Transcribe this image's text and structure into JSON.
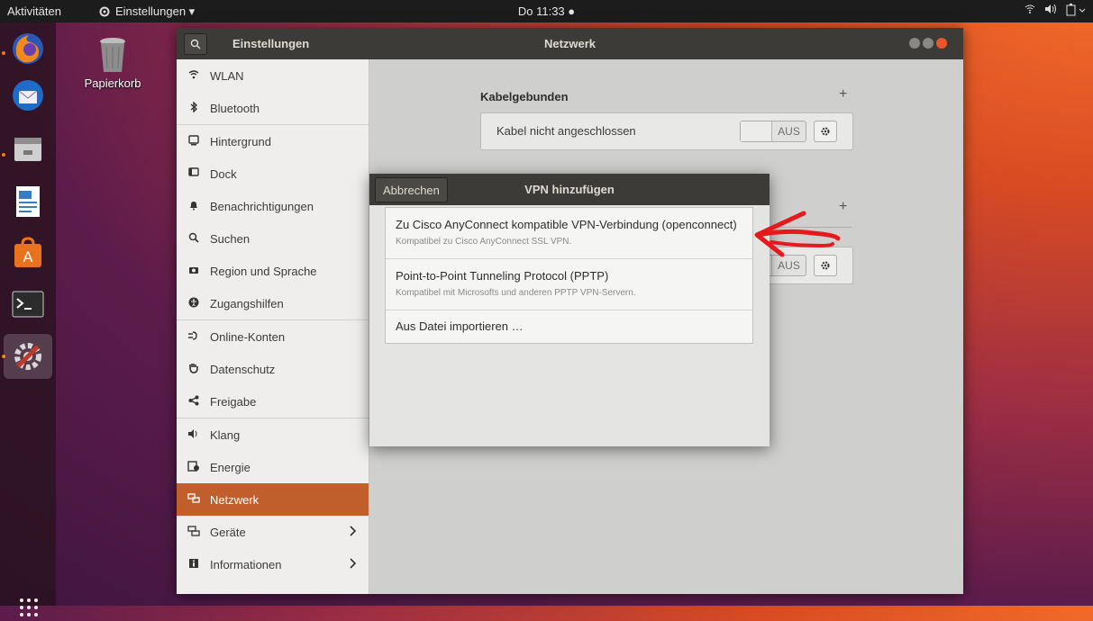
{
  "topbar": {
    "activities": "Aktivitäten",
    "app_menu": "Einstellungen ▾",
    "clock": "Do 11:33 ●"
  },
  "desktop": {
    "trash_label": "Papierkorb"
  },
  "window": {
    "sidebar_title": "Einstellungen",
    "title": "Netzwerk"
  },
  "sidebar": {
    "items": [
      {
        "label": "WLAN",
        "icon": "wifi-icon"
      },
      {
        "label": "Bluetooth",
        "icon": "bluetooth-icon"
      },
      {
        "label": "Hintergrund",
        "icon": "background-icon"
      },
      {
        "label": "Dock",
        "icon": "dock-icon"
      },
      {
        "label": "Benachrichtigungen",
        "icon": "bell-icon"
      },
      {
        "label": "Suchen",
        "icon": "search-icon"
      },
      {
        "label": "Region und Sprache",
        "icon": "camera-icon"
      },
      {
        "label": "Zugangshilfen",
        "icon": "accessibility-icon"
      },
      {
        "label": "Online-Konten",
        "icon": "online-accounts-icon"
      },
      {
        "label": "Datenschutz",
        "icon": "hand-icon"
      },
      {
        "label": "Freigabe",
        "icon": "share-icon"
      },
      {
        "label": "Klang",
        "icon": "speaker-icon"
      },
      {
        "label": "Energie",
        "icon": "battery-icon"
      },
      {
        "label": "Netzwerk",
        "icon": "network-icon"
      },
      {
        "label": "Geräte",
        "icon": "devices-icon"
      },
      {
        "label": "Informationen",
        "icon": "info-icon"
      }
    ]
  },
  "network": {
    "wired_title": "Kabelgebunden",
    "wired_status": "Kabel nicht angeschlossen",
    "toggle_off": "AUS",
    "vpn_toggle_partial": "AUS"
  },
  "vpn_dialog": {
    "cancel": "Abbrechen",
    "title": "VPN hinzufügen",
    "options": [
      {
        "title": "Zu Cisco AnyConnect kompatible VPN-Verbindung (openconnect)",
        "subtitle": "Kompatibel zu Cisco AnyConnect SSL VPN."
      },
      {
        "title": "Point-to-Point Tunneling Protocol (PPTP)",
        "subtitle": "Kompatibel mit Microsofts und anderen PPTP VPN-Servern."
      },
      {
        "title": "Aus Datei importieren …",
        "subtitle": ""
      }
    ]
  },
  "colors": {
    "selected": "#c15f2c",
    "annotation": "#e8191c"
  }
}
